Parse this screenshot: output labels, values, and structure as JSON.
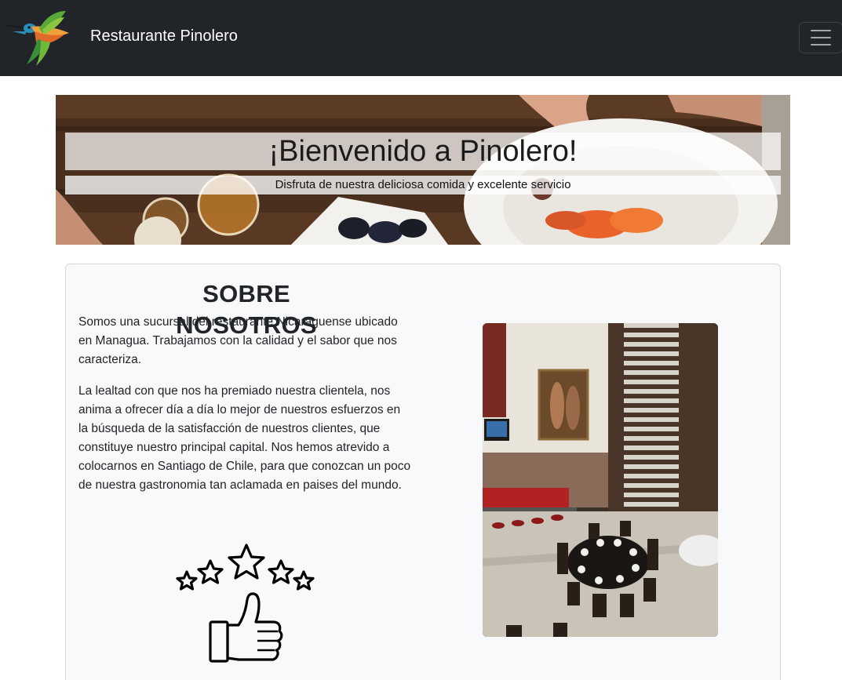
{
  "navbar": {
    "brand_name": "Restaurante Pinolero",
    "logo_icon": "hummingbird-logo",
    "menu_icon": "hamburger-menu-icon"
  },
  "hero": {
    "title": "¡Bienvenido a Pinolero!",
    "subtitle": "Disfruta de nuestra deliciosa comida y excelente servicio"
  },
  "about": {
    "title": "SOBRE NOSOTROS",
    "paragraph1": "Somos una sucursal del restaurante Nicaraguense ubicado en Managua. Trabajamos con la calidad y el sabor que nos caracteriza.",
    "paragraph2": "La lealtad con que nos ha premiado nuestra clientela, nos anima a ofrecer día a día lo mejor de nuestros esfuerzos en la búsqueda de la satisfacción de nuestros clientes, que constituye nuestro principal capital. Nos hemos atrevido a colocarnos en Santiago de Chile, para que conozcan un poco de nuestra gastronomia tan aclamada en paises del mundo.",
    "rating_icon": "five-stars-thumbs-up-icon",
    "photo_icon": "restaurant-interior-photo"
  },
  "colors": {
    "navbar_bg": "#212529",
    "card_bg": "#f8f9fa",
    "text": "#212529"
  }
}
